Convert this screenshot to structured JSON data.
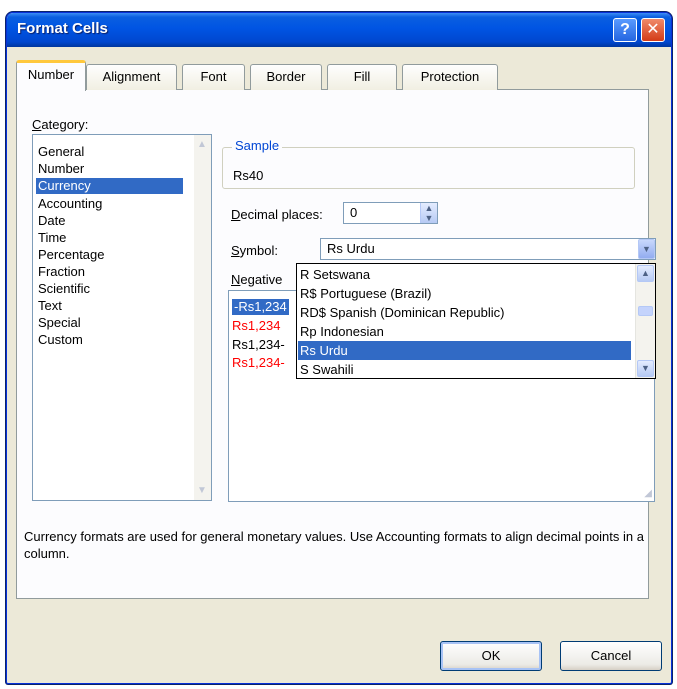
{
  "window": {
    "title": "Format Cells",
    "help_glyph": "?",
    "close_glyph": "✕"
  },
  "tabs": [
    {
      "label": "Number"
    },
    {
      "label": "Alignment"
    },
    {
      "label": "Font"
    },
    {
      "label": "Border"
    },
    {
      "label": "Fill"
    },
    {
      "label": "Protection"
    }
  ],
  "category": {
    "label_first": "C",
    "label_rest": "ategory:",
    "items": [
      "General",
      "Number",
      "Currency",
      "Accounting",
      "Date",
      "Time",
      "Percentage",
      "Fraction",
      "Scientific",
      "Text",
      "Special",
      "Custom"
    ],
    "selected": "Currency"
  },
  "sample": {
    "label": "Sample",
    "value": "Rs40"
  },
  "decimal_places": {
    "label_first": "D",
    "label_rest": "ecimal places:",
    "value": "0"
  },
  "symbol": {
    "label_first": "S",
    "label_rest": "ymbol:",
    "value": "Rs Urdu",
    "options": [
      "R Setswana",
      "R$  Portuguese (Brazil)",
      "RD$ Spanish (Dominican Republic)",
      "Rp Indonesian",
      "Rs Urdu",
      "S Swahili"
    ],
    "selected": "Rs Urdu"
  },
  "negative_numbers": {
    "label_first": "N",
    "label_rest": "egative",
    "items": [
      "-Rs1,234",
      "Rs1,234",
      "Rs1,234-",
      "Rs1,234-"
    ],
    "selected_index": 0
  },
  "description": "Currency formats are used for general monetary values.  Use Accounting formats to align decimal points in a column.",
  "buttons": {
    "ok": "OK",
    "cancel": "Cancel"
  },
  "colors": {
    "selection": "#316ac5",
    "negative_red": "#ff0000",
    "titlebar": "#0054e3",
    "dialog_bg": "#ece9d8"
  }
}
